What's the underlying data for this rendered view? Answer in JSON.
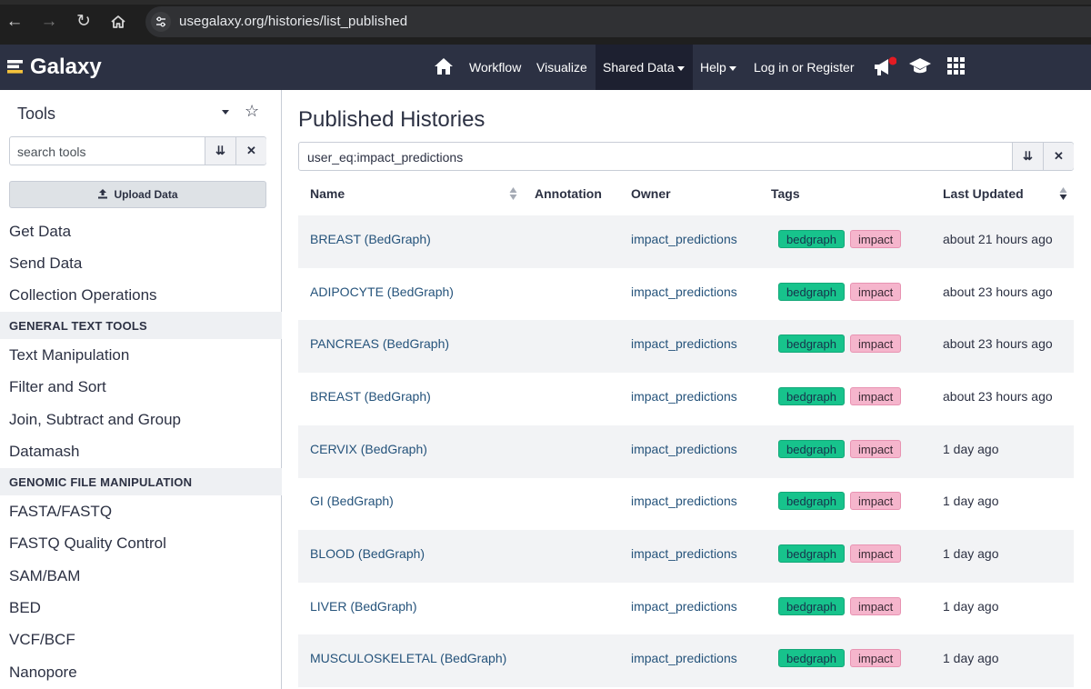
{
  "browser": {
    "url": "usegalaxy.org/histories/list_published"
  },
  "masthead": {
    "brand": "Galaxy",
    "nav": {
      "workflow": "Workflow",
      "visualize": "Visualize",
      "shared_data": "Shared Data",
      "help": "Help",
      "login": "Log in or Register"
    },
    "icons": [
      "home-icon",
      "megaphone-icon",
      "graduation-cap-icon",
      "grid-icon"
    ],
    "notification_color": "#e31b23"
  },
  "tool_panel": {
    "title": "Tools",
    "search_placeholder": "search tools",
    "upload_label": "Upload Data",
    "items": [
      {
        "type": "section",
        "label": "Get Data"
      },
      {
        "type": "section",
        "label": "Send Data"
      },
      {
        "type": "section",
        "label": "Collection Operations"
      },
      {
        "type": "label",
        "label": "GENERAL TEXT TOOLS"
      },
      {
        "type": "section",
        "label": "Text Manipulation"
      },
      {
        "type": "section",
        "label": "Filter and Sort"
      },
      {
        "type": "section",
        "label": "Join, Subtract and Group"
      },
      {
        "type": "section",
        "label": "Datamash"
      },
      {
        "type": "label",
        "label": "GENOMIC FILE MANIPULATION"
      },
      {
        "type": "section",
        "label": "FASTA/FASTQ"
      },
      {
        "type": "section",
        "label": "FASTQ Quality Control"
      },
      {
        "type": "section",
        "label": "SAM/BAM"
      },
      {
        "type": "section",
        "label": "BED"
      },
      {
        "type": "section",
        "label": "VCF/BCF"
      },
      {
        "type": "section",
        "label": "Nanopore"
      }
    ]
  },
  "main": {
    "title": "Published Histories",
    "filter_value": "user_eq:impact_predictions",
    "columns": {
      "name": "Name",
      "annotation": "Annotation",
      "owner": "Owner",
      "tags": "Tags",
      "updated": "Last Updated"
    },
    "rows": [
      {
        "name": "BREAST (BedGraph)",
        "owner": "impact_predictions",
        "tags": [
          "bedgraph",
          "impact"
        ],
        "updated": "about 21 hours ago"
      },
      {
        "name": "ADIPOCYTE (BedGraph)",
        "owner": "impact_predictions",
        "tags": [
          "bedgraph",
          "impact"
        ],
        "updated": "about 23 hours ago"
      },
      {
        "name": "PANCREAS (BedGraph)",
        "owner": "impact_predictions",
        "tags": [
          "bedgraph",
          "impact"
        ],
        "updated": "about 23 hours ago"
      },
      {
        "name": "BREAST (BedGraph)",
        "owner": "impact_predictions",
        "tags": [
          "bedgraph",
          "impact"
        ],
        "updated": "about 23 hours ago"
      },
      {
        "name": "CERVIX (BedGraph)",
        "owner": "impact_predictions",
        "tags": [
          "bedgraph",
          "impact"
        ],
        "updated": "1 day ago"
      },
      {
        "name": "GI (BedGraph)",
        "owner": "impact_predictions",
        "tags": [
          "bedgraph",
          "impact"
        ],
        "updated": "1 day ago"
      },
      {
        "name": "BLOOD (BedGraph)",
        "owner": "impact_predictions",
        "tags": [
          "bedgraph",
          "impact"
        ],
        "updated": "1 day ago"
      },
      {
        "name": "LIVER (BedGraph)",
        "owner": "impact_predictions",
        "tags": [
          "bedgraph",
          "impact"
        ],
        "updated": "1 day ago"
      },
      {
        "name": "MUSCULOSKELETAL (BedGraph)",
        "owner": "impact_predictions",
        "tags": [
          "bedgraph",
          "impact"
        ],
        "updated": "1 day ago"
      }
    ]
  },
  "colors": {
    "masthead": "#2c3143",
    "link": "#25537b",
    "tag_bedgraph": "#17c38c",
    "tag_impact": "#f5b5cc"
  }
}
